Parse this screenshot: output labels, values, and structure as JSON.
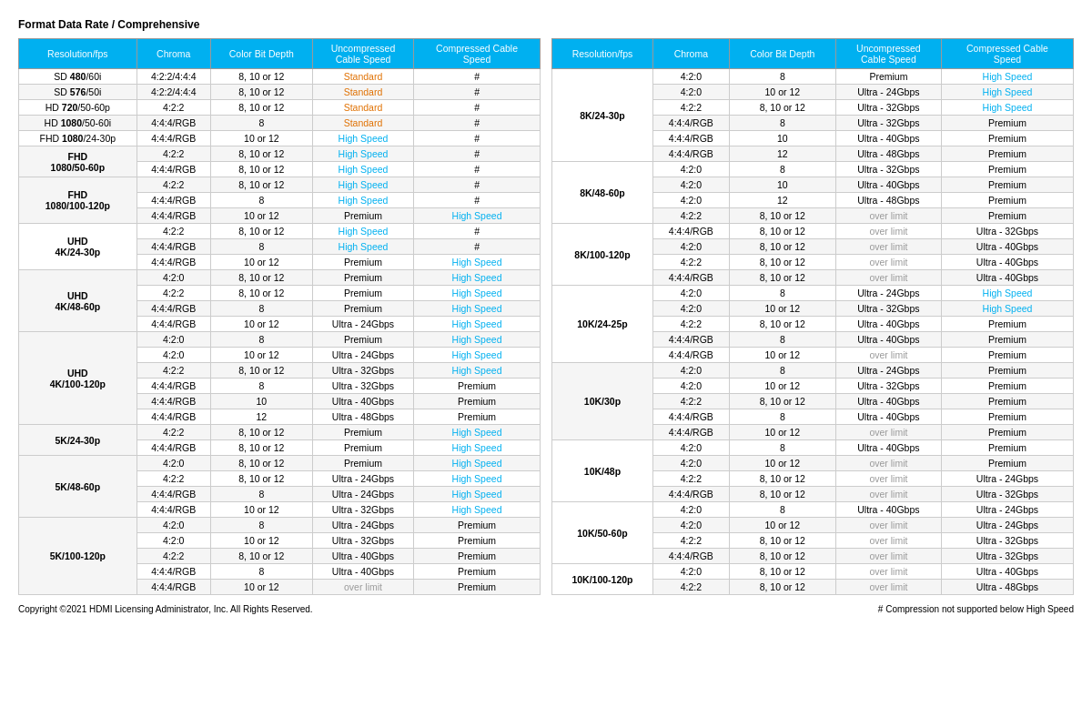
{
  "title": "Format Data Rate / Comprehensive",
  "headers": [
    "Resolution/fps",
    "Chroma",
    "Color Bit Depth",
    "Uncompressed Cable Speed",
    "Compressed Cable Speed"
  ],
  "left_table": [
    {
      "res": "SD 480/60i",
      "rowspan": 1,
      "chroma": "4:2:2/4:4:4",
      "bits": "8, 10 or 12",
      "uncomp": "Standard",
      "uncomp_color": "orange",
      "comp": "#",
      "comp_color": ""
    },
    {
      "res": "SD 576/50i",
      "rowspan": 1,
      "chroma": "4:2:2/4:4:4",
      "bits": "8, 10 or 12",
      "uncomp": "Standard",
      "uncomp_color": "orange",
      "comp": "#",
      "comp_color": ""
    },
    {
      "res": "HD 720/50-60p",
      "rowspan": 1,
      "chroma": "4:2:2",
      "bits": "8, 10 or 12",
      "uncomp": "Standard",
      "uncomp_color": "orange",
      "comp": "#",
      "comp_color": ""
    },
    {
      "res": "HD 1080/50-60i",
      "rowspan": 1,
      "chroma": "4:4:4/RGB",
      "bits": "8",
      "uncomp": "Standard",
      "uncomp_color": "orange",
      "comp": "#",
      "comp_color": ""
    },
    {
      "res": "FHD 1080/24-30p",
      "rowspan": 1,
      "chroma": "4:4:4/RGB",
      "bits": "10 or 12",
      "uncomp": "High Speed",
      "uncomp_color": "cyan",
      "comp": "#",
      "comp_color": ""
    },
    {
      "res_group": "FHD\n1080/50-60p",
      "rows": [
        {
          "chroma": "4:2:2",
          "bits": "8, 10 or 12",
          "uncomp": "High Speed",
          "uncomp_color": "cyan",
          "comp": "#",
          "comp_color": ""
        },
        {
          "chroma": "4:4:4/RGB",
          "bits": "8, 10 or 12",
          "uncomp": "High Speed",
          "uncomp_color": "cyan",
          "comp": "#",
          "comp_color": ""
        }
      ]
    },
    {
      "res_group": "FHD\n1080/100-120p",
      "rows": [
        {
          "chroma": "4:2:2",
          "bits": "8, 10 or 12",
          "uncomp": "High Speed",
          "uncomp_color": "cyan",
          "comp": "#",
          "comp_color": ""
        },
        {
          "chroma": "4:4:4/RGB",
          "bits": "8",
          "uncomp": "High Speed",
          "uncomp_color": "cyan",
          "comp": "#",
          "comp_color": ""
        },
        {
          "chroma": "4:4:4/RGB",
          "bits": "10 or 12",
          "uncomp": "Premium",
          "uncomp_color": "",
          "comp": "High Speed",
          "comp_color": "cyan"
        }
      ]
    },
    {
      "res_group": "UHD\n4K/24-30p",
      "rows": [
        {
          "chroma": "4:2:2",
          "bits": "8, 10 or 12",
          "uncomp": "High Speed",
          "uncomp_color": "cyan",
          "comp": "#",
          "comp_color": ""
        },
        {
          "chroma": "4:4:4/RGB",
          "bits": "8",
          "uncomp": "High Speed",
          "uncomp_color": "cyan",
          "comp": "#",
          "comp_color": ""
        },
        {
          "chroma": "4:4:4/RGB",
          "bits": "10 or 12",
          "uncomp": "Premium",
          "uncomp_color": "",
          "comp": "High Speed",
          "comp_color": "cyan"
        }
      ]
    },
    {
      "res_group": "UHD\n4K/48-60p",
      "rows": [
        {
          "chroma": "4:2:0",
          "bits": "8, 10 or 12",
          "uncomp": "Premium",
          "uncomp_color": "",
          "comp": "High Speed",
          "comp_color": "cyan"
        },
        {
          "chroma": "4:2:2",
          "bits": "8, 10 or 12",
          "uncomp": "Premium",
          "uncomp_color": "",
          "comp": "High Speed",
          "comp_color": "cyan"
        },
        {
          "chroma": "4:4:4/RGB",
          "bits": "8",
          "uncomp": "Premium",
          "uncomp_color": "",
          "comp": "High Speed",
          "comp_color": "cyan"
        },
        {
          "chroma": "4:4:4/RGB",
          "bits": "10 or 12",
          "uncomp": "Ultra - 24Gbps",
          "uncomp_color": "",
          "comp": "High Speed",
          "comp_color": "cyan"
        }
      ]
    },
    {
      "res_group": "UHD\n4K/100-120p",
      "rows": [
        {
          "chroma": "4:2:0",
          "bits": "8",
          "uncomp": "Premium",
          "uncomp_color": "",
          "comp": "High Speed",
          "comp_color": "cyan"
        },
        {
          "chroma": "4:2:0",
          "bits": "10 or 12",
          "uncomp": "Ultra - 24Gbps",
          "uncomp_color": "",
          "comp": "High Speed",
          "comp_color": "cyan"
        },
        {
          "chroma": "4:2:2",
          "bits": "8, 10 or 12",
          "uncomp": "Ultra - 32Gbps",
          "uncomp_color": "",
          "comp": "High Speed",
          "comp_color": "cyan"
        },
        {
          "chroma": "4:4:4/RGB",
          "bits": "8",
          "uncomp": "Ultra - 32Gbps",
          "uncomp_color": "",
          "comp": "Premium",
          "comp_color": ""
        },
        {
          "chroma": "4:4:4/RGB",
          "bits": "10",
          "uncomp": "Ultra - 40Gbps",
          "uncomp_color": "",
          "comp": "Premium",
          "comp_color": ""
        },
        {
          "chroma": "4:4:4/RGB",
          "bits": "12",
          "uncomp": "Ultra - 48Gbps",
          "uncomp_color": "",
          "comp": "Premium",
          "comp_color": ""
        }
      ]
    },
    {
      "res_group": "5K/24-30p",
      "rows": [
        {
          "chroma": "4:2:2",
          "bits": "8, 10 or 12",
          "uncomp": "Premium",
          "uncomp_color": "",
          "comp": "High Speed",
          "comp_color": "cyan"
        },
        {
          "chroma": "4:4:4/RGB",
          "bits": "8, 10 or 12",
          "uncomp": "Premium",
          "uncomp_color": "",
          "comp": "High Speed",
          "comp_color": "cyan"
        }
      ]
    },
    {
      "res_group": "5K/48-60p",
      "rows": [
        {
          "chroma": "4:2:0",
          "bits": "8, 10 or 12",
          "uncomp": "Premium",
          "uncomp_color": "",
          "comp": "High Speed",
          "comp_color": "cyan"
        },
        {
          "chroma": "4:2:2",
          "bits": "8, 10 or 12",
          "uncomp": "Ultra - 24Gbps",
          "uncomp_color": "",
          "comp": "High Speed",
          "comp_color": "cyan"
        },
        {
          "chroma": "4:4:4/RGB",
          "bits": "8",
          "uncomp": "Ultra - 24Gbps",
          "uncomp_color": "",
          "comp": "High Speed",
          "comp_color": "cyan"
        },
        {
          "chroma": "4:4:4/RGB",
          "bits": "10 or 12",
          "uncomp": "Ultra - 32Gbps",
          "uncomp_color": "",
          "comp": "High Speed",
          "comp_color": "cyan"
        }
      ]
    },
    {
      "res_group": "5K/100-120p",
      "rows": [
        {
          "chroma": "4:2:0",
          "bits": "8",
          "uncomp": "Ultra - 24Gbps",
          "uncomp_color": "",
          "comp": "Premium",
          "comp_color": ""
        },
        {
          "chroma": "4:2:0",
          "bits": "10 or 12",
          "uncomp": "Ultra - 32Gbps",
          "uncomp_color": "",
          "comp": "Premium",
          "comp_color": ""
        },
        {
          "chroma": "4:2:2",
          "bits": "8, 10 or 12",
          "uncomp": "Ultra - 40Gbps",
          "uncomp_color": "",
          "comp": "Premium",
          "comp_color": ""
        },
        {
          "chroma": "4:4:4/RGB",
          "bits": "8",
          "uncomp": "Ultra - 40Gbps",
          "uncomp_color": "",
          "comp": "Premium",
          "comp_color": ""
        },
        {
          "chroma": "4:4:4/RGB",
          "bits": "10 or 12",
          "uncomp": "over limit",
          "uncomp_color": "gray",
          "comp": "Premium",
          "comp_color": ""
        }
      ]
    }
  ],
  "right_table": [
    {
      "res_group": "8K/24-30p",
      "rows": [
        {
          "chroma": "4:2:0",
          "bits": "8",
          "uncomp": "Premium",
          "uncomp_color": "",
          "comp": "High Speed",
          "comp_color": "cyan"
        },
        {
          "chroma": "4:2:0",
          "bits": "10 or 12",
          "uncomp": "Ultra - 24Gbps",
          "uncomp_color": "",
          "comp": "High Speed",
          "comp_color": "cyan"
        },
        {
          "chroma": "4:2:2",
          "bits": "8, 10 or 12",
          "uncomp": "Ultra - 32Gbps",
          "uncomp_color": "",
          "comp": "High Speed",
          "comp_color": "cyan"
        },
        {
          "chroma": "4:4:4/RGB",
          "bits": "8",
          "uncomp": "Ultra - 32Gbps",
          "uncomp_color": "",
          "comp": "Premium",
          "comp_color": ""
        },
        {
          "chroma": "4:4:4/RGB",
          "bits": "10",
          "uncomp": "Ultra - 40Gbps",
          "uncomp_color": "",
          "comp": "Premium",
          "comp_color": ""
        },
        {
          "chroma": "4:4:4/RGB",
          "bits": "12",
          "uncomp": "Ultra - 48Gbps",
          "uncomp_color": "",
          "comp": "Premium",
          "comp_color": ""
        }
      ]
    },
    {
      "res_group": "8K/48-60p",
      "rows": [
        {
          "chroma": "4:2:0",
          "bits": "8",
          "uncomp": "Ultra - 32Gbps",
          "uncomp_color": "",
          "comp": "Premium",
          "comp_color": ""
        },
        {
          "chroma": "4:2:0",
          "bits": "10",
          "uncomp": "Ultra - 40Gbps",
          "uncomp_color": "",
          "comp": "Premium",
          "comp_color": ""
        },
        {
          "chroma": "4:2:0",
          "bits": "12",
          "uncomp": "Ultra - 48Gbps",
          "uncomp_color": "",
          "comp": "Premium",
          "comp_color": ""
        },
        {
          "chroma": "4:2:2",
          "bits": "8, 10 or 12",
          "uncomp": "over limit",
          "uncomp_color": "gray",
          "comp": "Premium",
          "comp_color": ""
        }
      ]
    },
    {
      "res_group": "8K/100-120p",
      "rows": [
        {
          "chroma": "4:4:4/RGB",
          "bits": "8, 10 or 12",
          "uncomp": "over limit",
          "uncomp_color": "gray",
          "comp": "Ultra - 32Gbps",
          "comp_color": ""
        },
        {
          "chroma": "4:2:0",
          "bits": "8, 10 or 12",
          "uncomp": "over limit",
          "uncomp_color": "gray",
          "comp": "Ultra - 40Gbps",
          "comp_color": ""
        },
        {
          "chroma": "4:2:2",
          "bits": "8, 10 or 12",
          "uncomp": "over limit",
          "uncomp_color": "gray",
          "comp": "Ultra - 40Gbps",
          "comp_color": ""
        },
        {
          "chroma": "4:4:4/RGB",
          "bits": "8, 10 or 12",
          "uncomp": "over limit",
          "uncomp_color": "gray",
          "comp": "Ultra - 40Gbps",
          "comp_color": ""
        }
      ]
    },
    {
      "res_group": "10K/24-25p",
      "rows": [
        {
          "chroma": "4:2:0",
          "bits": "8",
          "uncomp": "Ultra - 24Gbps",
          "uncomp_color": "",
          "comp": "High Speed",
          "comp_color": "cyan"
        },
        {
          "chroma": "4:2:0",
          "bits": "10 or 12",
          "uncomp": "Ultra - 32Gbps",
          "uncomp_color": "",
          "comp": "High Speed",
          "comp_color": "cyan"
        },
        {
          "chroma": "4:2:2",
          "bits": "8, 10 or 12",
          "uncomp": "Ultra - 40Gbps",
          "uncomp_color": "",
          "comp": "Premium",
          "comp_color": ""
        },
        {
          "chroma": "4:4:4/RGB",
          "bits": "8",
          "uncomp": "Ultra - 40Gbps",
          "uncomp_color": "",
          "comp": "Premium",
          "comp_color": ""
        },
        {
          "chroma": "4:4:4/RGB",
          "bits": "10 or 12",
          "uncomp": "over limit",
          "uncomp_color": "gray",
          "comp": "Premium",
          "comp_color": ""
        }
      ]
    },
    {
      "res_group": "10K/30p",
      "rows": [
        {
          "chroma": "4:2:0",
          "bits": "8",
          "uncomp": "Ultra - 24Gbps",
          "uncomp_color": "",
          "comp": "Premium",
          "comp_color": ""
        },
        {
          "chroma": "4:2:0",
          "bits": "10 or 12",
          "uncomp": "Ultra - 32Gbps",
          "uncomp_color": "",
          "comp": "Premium",
          "comp_color": ""
        },
        {
          "chroma": "4:2:2",
          "bits": "8, 10 or 12",
          "uncomp": "Ultra - 40Gbps",
          "uncomp_color": "",
          "comp": "Premium",
          "comp_color": ""
        },
        {
          "chroma": "4:4:4/RGB",
          "bits": "8",
          "uncomp": "Ultra - 40Gbps",
          "uncomp_color": "",
          "comp": "Premium",
          "comp_color": ""
        },
        {
          "chroma": "4:4:4/RGB",
          "bits": "10 or 12",
          "uncomp": "over limit",
          "uncomp_color": "gray",
          "comp": "Premium",
          "comp_color": ""
        }
      ]
    },
    {
      "res_group": "10K/48p",
      "rows": [
        {
          "chroma": "4:2:0",
          "bits": "8",
          "uncomp": "Ultra - 40Gbps",
          "uncomp_color": "",
          "comp": "Premium",
          "comp_color": ""
        },
        {
          "chroma": "4:2:0",
          "bits": "10 or 12",
          "uncomp": "over limit",
          "uncomp_color": "gray",
          "comp": "Premium",
          "comp_color": ""
        },
        {
          "chroma": "4:2:2",
          "bits": "8, 10 or 12",
          "uncomp": "over limit",
          "uncomp_color": "gray",
          "comp": "Ultra - 24Gbps",
          "comp_color": ""
        },
        {
          "chroma": "4:4:4/RGB",
          "bits": "8, 10 or 12",
          "uncomp": "over limit",
          "uncomp_color": "gray",
          "comp": "Ultra - 32Gbps",
          "comp_color": ""
        }
      ]
    },
    {
      "res_group": "10K/50-60p",
      "rows": [
        {
          "chroma": "4:2:0",
          "bits": "8",
          "uncomp": "Ultra - 40Gbps",
          "uncomp_color": "",
          "comp": "Ultra - 24Gbps",
          "comp_color": ""
        },
        {
          "chroma": "4:2:0",
          "bits": "10 or 12",
          "uncomp": "over limit",
          "uncomp_color": "gray",
          "comp": "Ultra - 24Gbps",
          "comp_color": ""
        },
        {
          "chroma": "4:2:2",
          "bits": "8, 10 or 12",
          "uncomp": "over limit",
          "uncomp_color": "gray",
          "comp": "Ultra - 32Gbps",
          "comp_color": ""
        },
        {
          "chroma": "4:4:4/RGB",
          "bits": "8, 10 or 12",
          "uncomp": "over limit",
          "uncomp_color": "gray",
          "comp": "Ultra - 32Gbps",
          "comp_color": ""
        }
      ]
    },
    {
      "res_group": "10K/100-120p",
      "rows": [
        {
          "chroma": "4:2:0",
          "bits": "8, 10 or 12",
          "uncomp": "over limit",
          "uncomp_color": "gray",
          "comp": "Ultra - 40Gbps",
          "comp_color": ""
        },
        {
          "chroma": "4:2:2",
          "bits": "8, 10 or 12",
          "uncomp": "over limit",
          "uncomp_color": "gray",
          "comp": "Ultra - 48Gbps",
          "comp_color": ""
        }
      ]
    }
  ],
  "footer": {
    "copyright": "Copyright ©2021 HDMI Licensing Administrator, Inc. All Rights Reserved.",
    "note": "# Compression not supported below High Speed"
  }
}
